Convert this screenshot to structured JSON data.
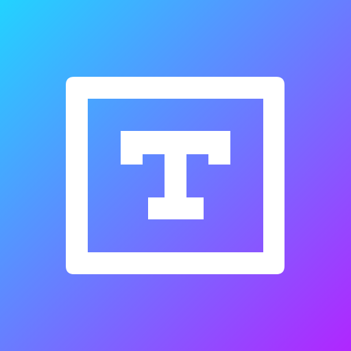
{
  "icon": {
    "name": "text-box-icon",
    "gradient": {
      "start_color": "#22D3FF",
      "end_color": "#B026FF",
      "direction": "top-left-to-bottom-right"
    },
    "glyph_color": "#FFFFFF"
  }
}
